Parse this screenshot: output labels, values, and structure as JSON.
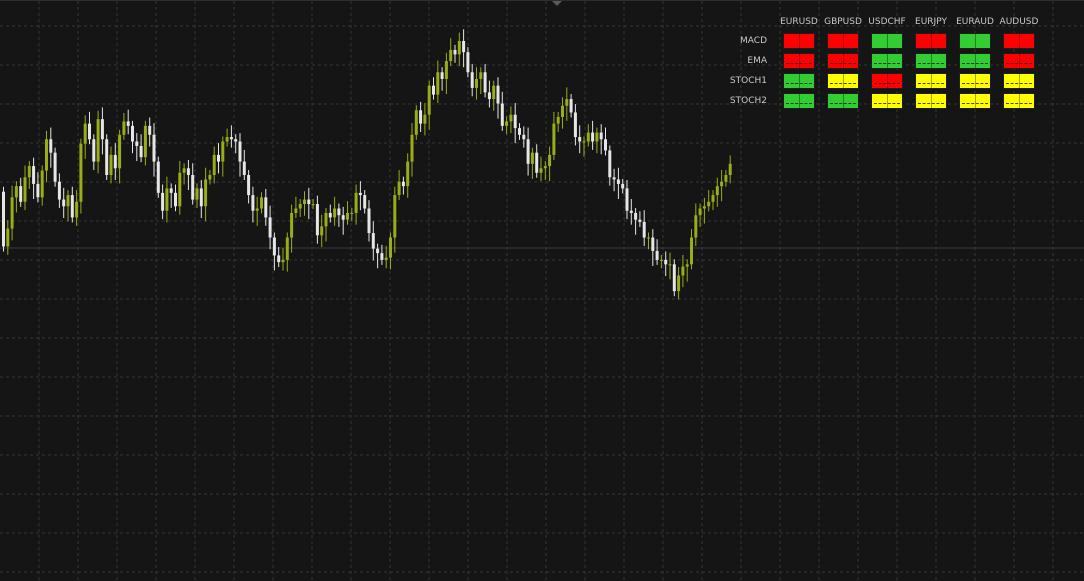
{
  "signal_panel": {
    "pairs": [
      "EURUSD",
      "GBPUSD",
      "USDCHF",
      "EURJPY",
      "EURAUD",
      "AUDUSD"
    ],
    "rows": [
      {
        "indicator": "MACD",
        "signals": [
          "red",
          "red",
          "green",
          "red",
          "green",
          "red"
        ]
      },
      {
        "indicator": "EMA",
        "signals": [
          "red",
          "red",
          "green",
          "green",
          "green",
          "red"
        ]
      },
      {
        "indicator": "STOCH1",
        "signals": [
          "green",
          "yellow",
          "red",
          "yellow",
          "yellow",
          "yellow"
        ]
      },
      {
        "indicator": "STOCH2",
        "signals": [
          "green",
          "green",
          "yellow",
          "yellow",
          "yellow",
          "yellow"
        ]
      }
    ]
  },
  "colors": {
    "background": "#151515",
    "grid": "#353535",
    "bull_candle": "#9aad17",
    "bear_candle": "#e6e6e6",
    "signal_red": "#ff0000",
    "signal_green": "#32cd32",
    "signal_yellow": "#ffff00"
  },
  "chart_data": {
    "type": "candlestick",
    "description": "Price candles, relative price 0-100",
    "ylim": [
      0,
      100
    ],
    "grid": true,
    "close": [
      58,
      66,
      80,
      85,
      78,
      89,
      94,
      86,
      80,
      92,
      106,
      100,
      87,
      79,
      76,
      81,
      71,
      78,
      104,
      113,
      106,
      96,
      115,
      106,
      90,
      99,
      93,
      108,
      114,
      112,
      105,
      103,
      98,
      112,
      108,
      96,
      82,
      74,
      84,
      82,
      76,
      91,
      93,
      90,
      79,
      84,
      76,
      88,
      90,
      99,
      96,
      105,
      107,
      106,
      105,
      96,
      90,
      81,
      74,
      75,
      80,
      71,
      62,
      54,
      51,
      52,
      62,
      73,
      75,
      77,
      79,
      77,
      77,
      63,
      67,
      73,
      71,
      75,
      72,
      70,
      73,
      73,
      82,
      81,
      75,
      64,
      57,
      55,
      52,
      53,
      62,
      81,
      87,
      85,
      96,
      108,
      119,
      113,
      117,
      130,
      126,
      136,
      133,
      141,
      146,
      144,
      150,
      145,
      136,
      129,
      133,
      136,
      127,
      124,
      130,
      122,
      112,
      114,
      117,
      111,
      108,
      106,
      95,
      100,
      91,
      93,
      94,
      99,
      113,
      116,
      121,
      124,
      118,
      107,
      105,
      105,
      109,
      105,
      109,
      106,
      101,
      89,
      88,
      86,
      84,
      74,
      73,
      70,
      69,
      62,
      62,
      56,
      52,
      52,
      50,
      50,
      38,
      45,
      49,
      50,
      62,
      72,
      75,
      76,
      78,
      81,
      85,
      87,
      90,
      95
    ]
  }
}
